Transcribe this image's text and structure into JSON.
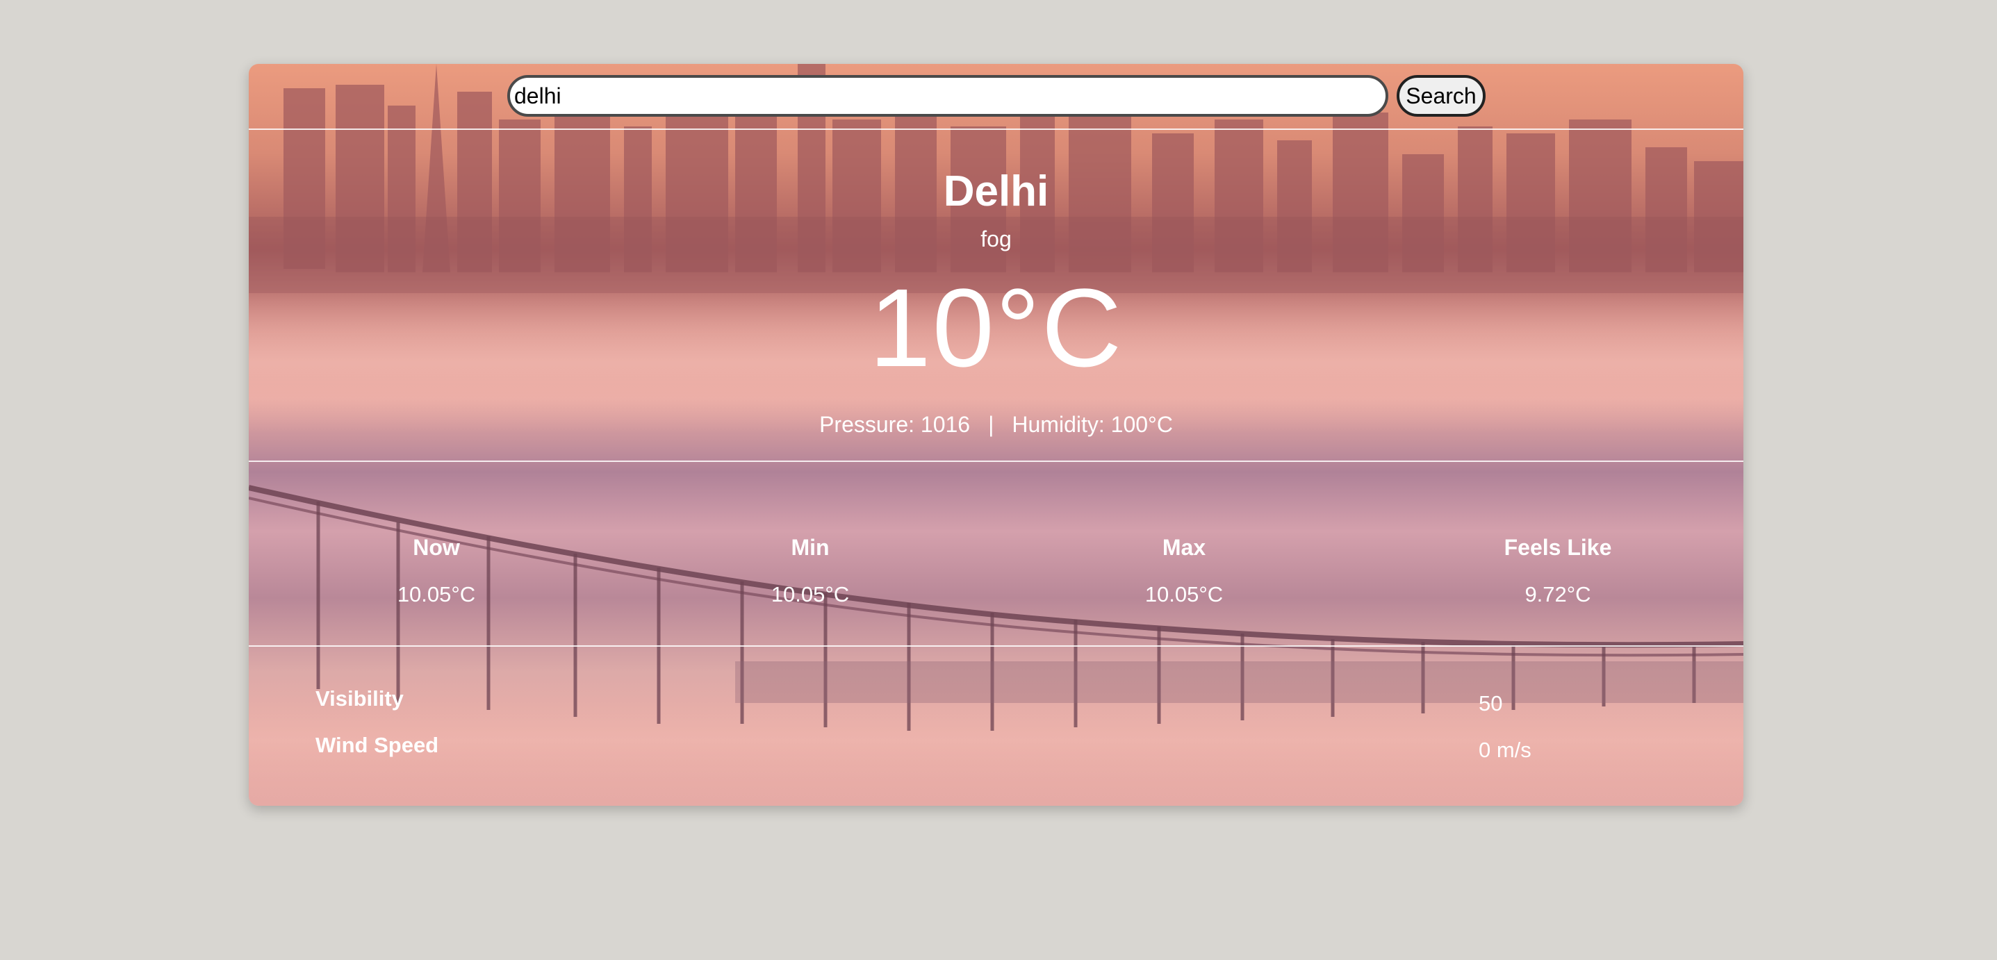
{
  "search": {
    "value": "delhi",
    "button_label": "Search"
  },
  "weather": {
    "city": "Delhi",
    "condition": "fog",
    "temperature": "10°C",
    "pressure_text": "Pressure: 1016",
    "separator": "|",
    "humidity_text": "Humidity: 100°C"
  },
  "stats": [
    {
      "label": "Now",
      "value": "10.05°C"
    },
    {
      "label": "Min",
      "value": "10.05°C"
    },
    {
      "label": "Max",
      "value": "10.05°C"
    },
    {
      "label": "Feels Like",
      "value": "9.72°C"
    }
  ],
  "extra": [
    {
      "label": "Visibility",
      "value": "50"
    },
    {
      "label": "Wind Speed",
      "value": "0 m/s"
    }
  ],
  "colors": {
    "page_background": "#d8d6d1",
    "text": "#ffffff",
    "sky_top": "#e99a7e",
    "fog_pink": "#e6a7a3",
    "fog_purple": "#a57d98"
  },
  "background_image": "foggy-city-bridge-image"
}
